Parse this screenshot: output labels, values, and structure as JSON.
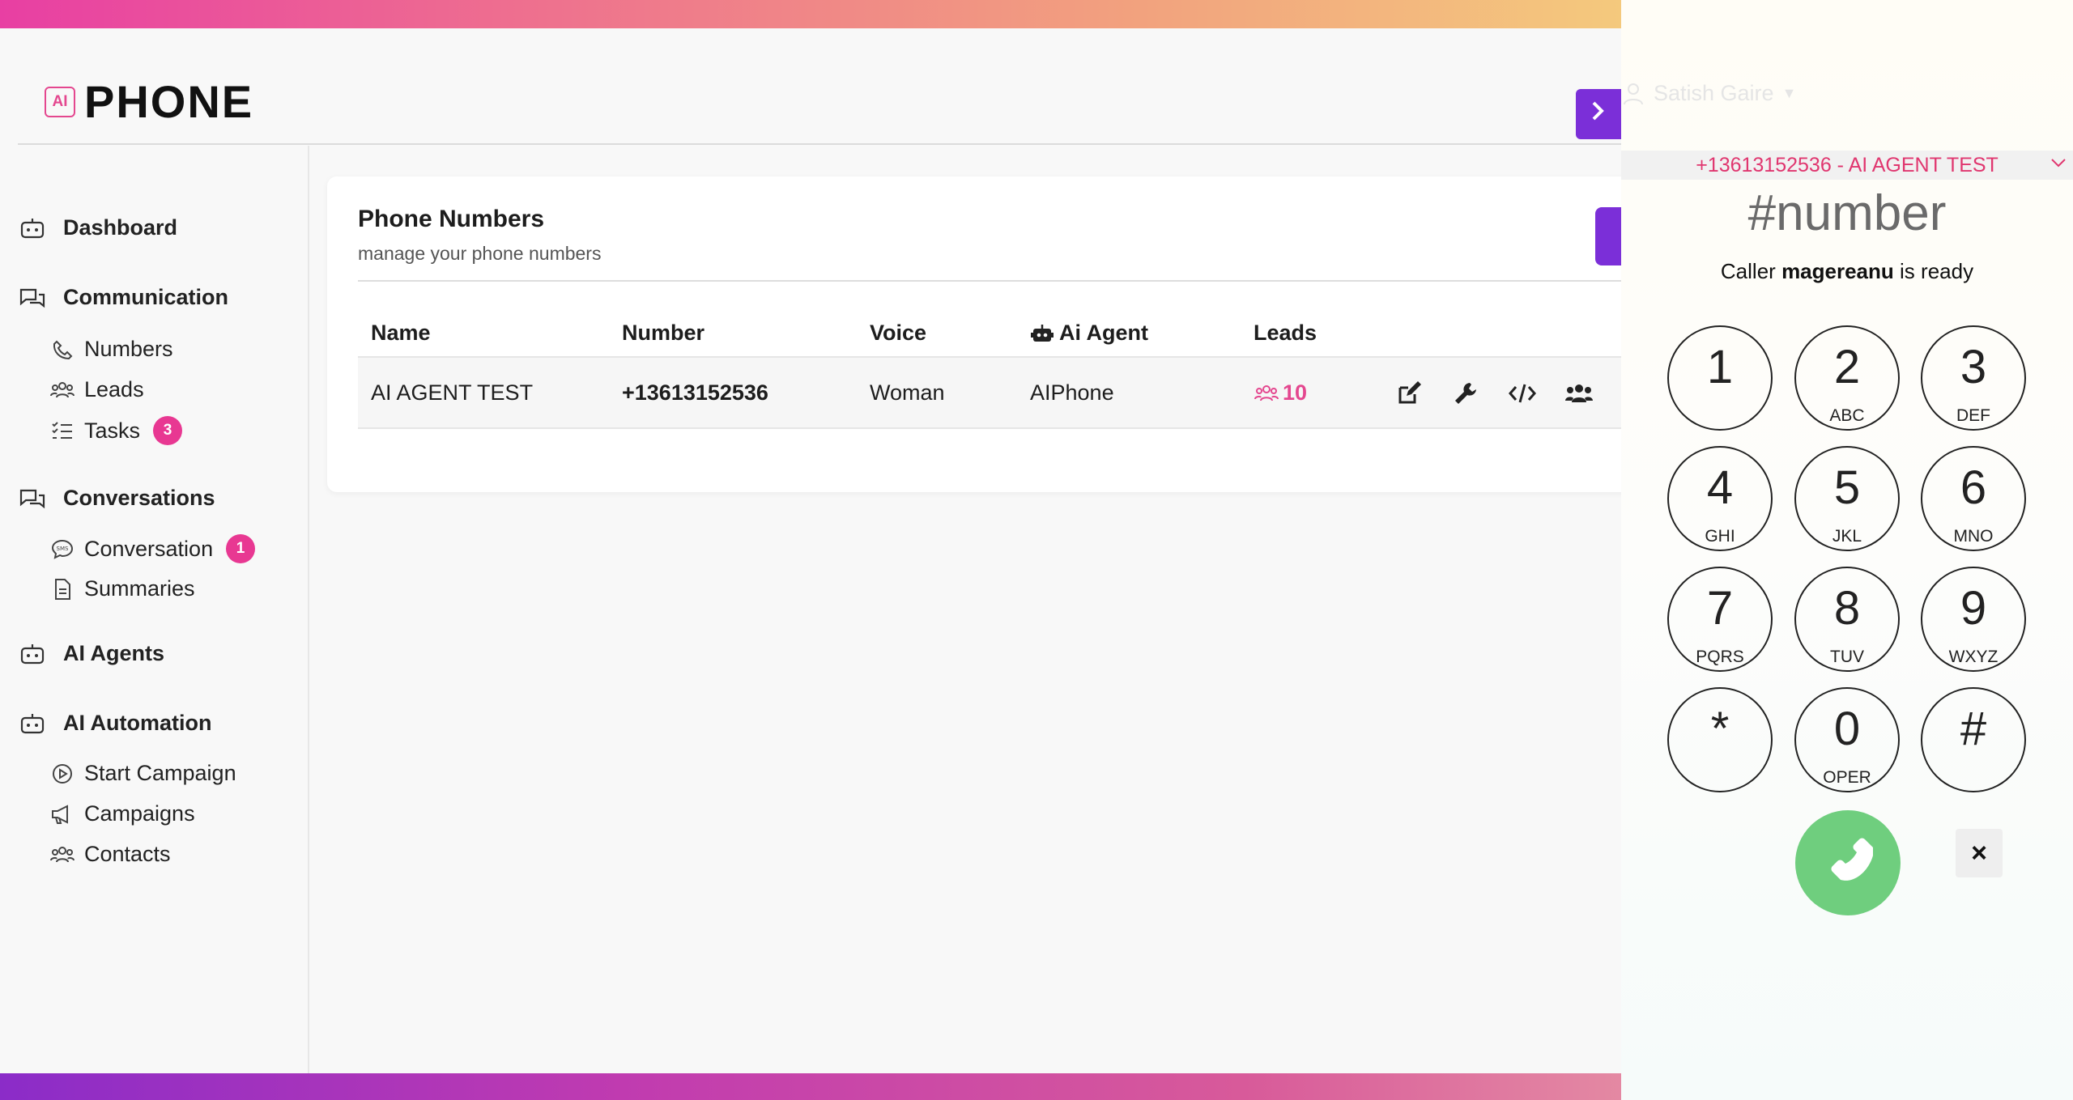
{
  "app": {
    "logo_badge": "AI",
    "logo_text": "PHONE"
  },
  "sidebar": {
    "sections": [
      {
        "label": "Dashboard",
        "icon": "robot-icon"
      },
      {
        "label": "Communication",
        "icon": "chat-icon",
        "items": [
          {
            "label": "Numbers",
            "icon": "phone-icon"
          },
          {
            "label": "Leads",
            "icon": "users-icon"
          },
          {
            "label": "Tasks",
            "icon": "checklist-icon",
            "badge": "3"
          }
        ]
      },
      {
        "label": "Conversations",
        "icon": "chat-icon",
        "items": [
          {
            "label": "Conversation",
            "icon": "sms-icon",
            "badge": "1"
          },
          {
            "label": "Summaries",
            "icon": "document-icon"
          }
        ]
      },
      {
        "label": "AI Agents",
        "icon": "robot-icon"
      },
      {
        "label": "AI Automation",
        "icon": "robot-icon",
        "items": [
          {
            "label": "Start Campaign",
            "icon": "play-icon"
          },
          {
            "label": "Campaigns",
            "icon": "megaphone-icon"
          },
          {
            "label": "Contacts",
            "icon": "users-icon"
          }
        ]
      }
    ]
  },
  "main": {
    "title": "Phone Numbers",
    "subtitle": "manage your phone numbers",
    "columns": [
      "Name",
      "Number",
      "Voice",
      "Ai Agent",
      "Leads"
    ],
    "rows": [
      {
        "name": "AI AGENT TEST",
        "number": "+13613152536",
        "voice": "Woman",
        "agent": "AIPhone",
        "leads": "10"
      }
    ]
  },
  "user": {
    "name": "Satish Gaire"
  },
  "dialer": {
    "caller_id": "+13613152536 - AI AGENT TEST",
    "number_placeholder": "#number",
    "status_prefix": "Caller",
    "caller_name": "magereanu",
    "status_suffix": "is ready",
    "keys": [
      {
        "digit": "1",
        "letters": ""
      },
      {
        "digit": "2",
        "letters": "ABC"
      },
      {
        "digit": "3",
        "letters": "DEF"
      },
      {
        "digit": "4",
        "letters": "GHI"
      },
      {
        "digit": "5",
        "letters": "JKL"
      },
      {
        "digit": "6",
        "letters": "MNO"
      },
      {
        "digit": "7",
        "letters": "PQRS"
      },
      {
        "digit": "8",
        "letters": "TUV"
      },
      {
        "digit": "9",
        "letters": "WXYZ"
      },
      {
        "digit": "*",
        "letters": ""
      },
      {
        "digit": "0",
        "letters": "OPER"
      },
      {
        "digit": "#",
        "letters": ""
      }
    ],
    "clear_label": "×"
  },
  "colors": {
    "accent_purple": "#7b2fd8",
    "accent_pink": "#e4478f",
    "call_green": "#6fce7e"
  }
}
